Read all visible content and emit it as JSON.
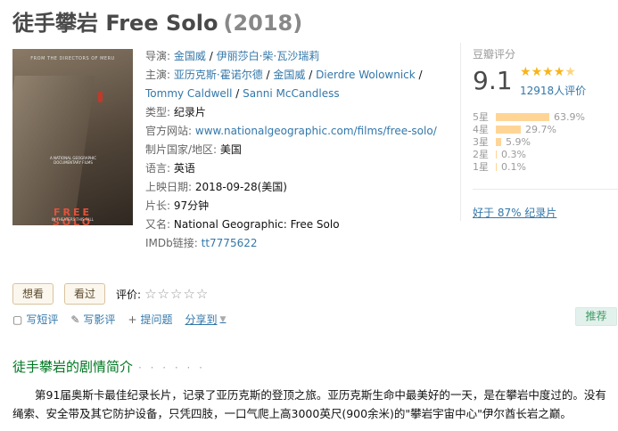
{
  "title": {
    "name": "徒手攀岩 Free Solo",
    "year": "(2018)"
  },
  "poster": {
    "tagline": "FROM THE DIRECTORS OF MERU",
    "blurb": "A NATIONAL GEOGRAPHIC DOCUMENTARY FILMS",
    "title_line1": "FREE",
    "title_line2": "SOLO",
    "bottom": "IN THEATERS THIS FALL"
  },
  "info": {
    "director_label": "导演:",
    "directors": [
      "金国威",
      "伊丽莎白·柴·瓦沙瑞莉"
    ],
    "cast_label": "主演:",
    "cast": [
      "亚历克斯·霍诺尔德",
      "金国威",
      "Dierdre Wolownick",
      "Tommy Caldwell",
      "Sanni McCandless"
    ],
    "genre_label": "类型:",
    "genre": "纪录片",
    "site_label": "官方网站:",
    "site": "www.nationalgeographic.com/films/free-solo/",
    "country_label": "制片国家/地区:",
    "country": "美国",
    "lang_label": "语言:",
    "lang": "英语",
    "date_label": "上映日期:",
    "date": "2018-09-28(美国)",
    "runtime_label": "片长:",
    "runtime": "97分钟",
    "aka_label": "又名:",
    "aka": "National Geographic: Free Solo",
    "imdb_label": "IMDb链接:",
    "imdb": "tt7775622"
  },
  "rating": {
    "title": "豆瓣评分",
    "score": "9.1",
    "stars": 4.5,
    "count": "12918人评价",
    "bars": [
      {
        "label": "5星",
        "pct": "63.9%",
        "value": 63.9
      },
      {
        "label": "4星",
        "pct": "29.7%",
        "value": 29.7
      },
      {
        "label": "3星",
        "pct": "5.9%",
        "value": 5.9
      },
      {
        "label": "2星",
        "pct": "0.3%",
        "value": 0.3
      },
      {
        "label": "1星",
        "pct": "0.1%",
        "value": 0.1
      }
    ],
    "better_than": "好于 87% 纪录片"
  },
  "actions": {
    "want": "想看",
    "seen": "看过",
    "rate_label": "评价:",
    "stars": "☆☆☆☆☆"
  },
  "tools": {
    "short_review": "写短评",
    "review": "写影评",
    "ask": "提问题",
    "share": "分享到",
    "recommend": "推荐"
  },
  "intro": {
    "heading": "徒手攀岩的剧情简介",
    "dots": "· · · · · ·",
    "text": "第91届奥斯卡最佳纪录长片，记录了亚历克斯的登顶之旅。亚历克斯生命中最美好的一天，是在攀岩中度过的。没有绳索、安全带及其它防护设备，只凭四肢，一口气爬上高3000英尺(900余米)的\"攀岩宇宙中心\"伊尔酋长岩之巅。"
  },
  "colors": {
    "link": "#3377aa",
    "heading": "#007722",
    "star": "#f8b418",
    "bar": "#ffd596"
  }
}
